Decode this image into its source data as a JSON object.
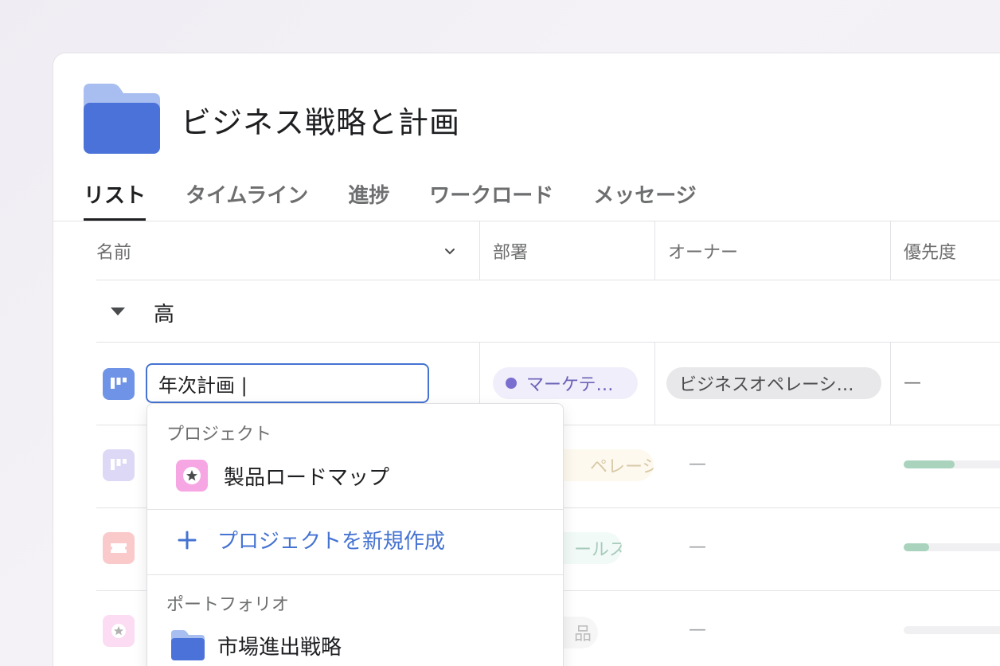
{
  "page": {
    "title": "ビジネス戦略と計画"
  },
  "tabs": [
    {
      "label": "リスト",
      "active": true
    },
    {
      "label": "タイムライン",
      "active": false
    },
    {
      "label": "進捗",
      "active": false
    },
    {
      "label": "ワークロード",
      "active": false
    },
    {
      "label": "メッセージ",
      "active": false
    }
  ],
  "columns": {
    "name": "名前",
    "department": "部署",
    "owner": "オーナー",
    "priority": "優先度"
  },
  "group": {
    "label": "高"
  },
  "rows": [
    {
      "name_input": "年次計画 |",
      "department": "マーケテ…",
      "owner": "ビジネスオペレーシ…",
      "priority": "—"
    },
    {
      "department": "ペレーシ…",
      "owner": "—",
      "progress": 0.46
    },
    {
      "department": "ールス",
      "owner": "—",
      "progress": 0.23
    },
    {
      "department": "品",
      "owner": "—",
      "progress": 0.0
    }
  ],
  "dropdown": {
    "projects_header": "プロジェクト",
    "project_item": "製品ロードマップ",
    "create_label": "プロジェクトを新規作成",
    "portfolio_header": "ポートフォリオ",
    "portfolio_item": "市場進出戦略"
  },
  "colors": {
    "accent_blue": "#4573d2",
    "folder_blue": "#4a72d8",
    "marketing_dot": "#7a6fd0",
    "progress_green": "#a9d3bd"
  }
}
